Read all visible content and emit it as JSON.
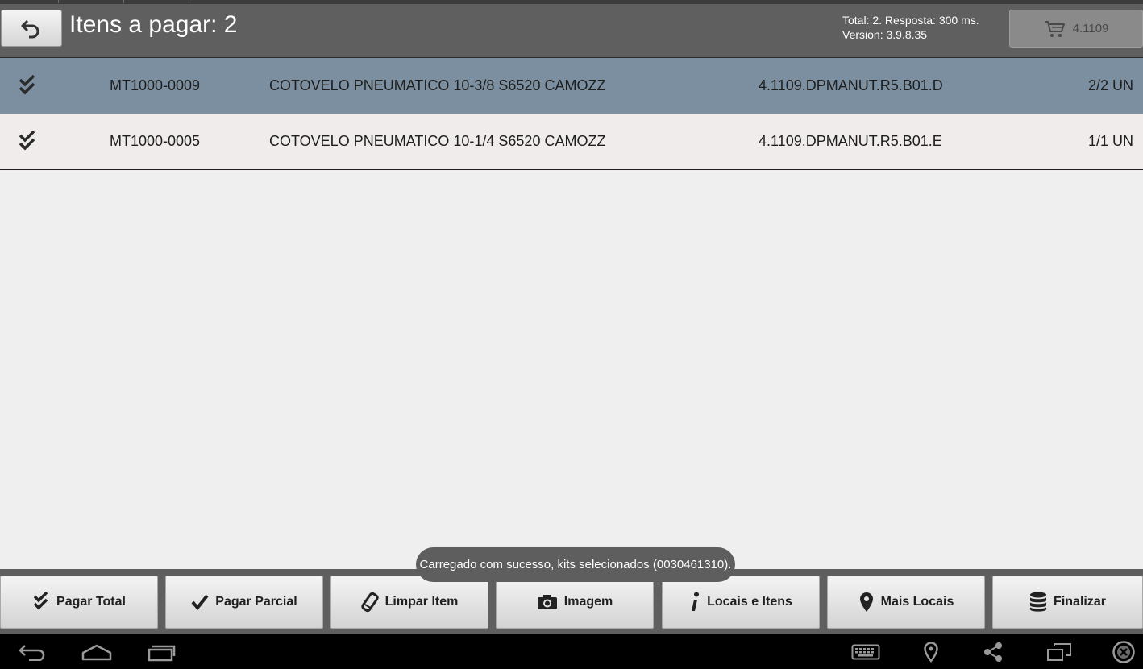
{
  "header": {
    "title": "Itens a pagar: 2",
    "status_line1": "Total: 2. Resposta: 300 ms.",
    "status_line2": "Version: 3.9.8.35",
    "cart_label": "4.1109",
    "back_icon": "undo-arrow-icon",
    "cart_icon": "shopping-cart-icon"
  },
  "items": [
    {
      "code": "MT1000-0009",
      "description": "COTOVELO PNEUMATICO 10-3/8 S6520 CAMOZZ",
      "location": "4.1109.DPMANUT.R5.B01.D",
      "quantity": "2/2 UN",
      "icon": "double-check-icon",
      "selected": true
    },
    {
      "code": "MT1000-0005",
      "description": "COTOVELO PNEUMATICO 10-1/4 S6520 CAMOZZ",
      "location": "4.1109.DPMANUT.R5.B01.E",
      "quantity": "1/1 UN",
      "icon": "double-check-icon",
      "selected": false
    }
  ],
  "toast": "Carregado com sucesso, kits selecionados (0030461310).",
  "actions": [
    {
      "label": "Pagar Total",
      "icon": "double-check-icon"
    },
    {
      "label": "Pagar Parcial",
      "icon": "check-icon"
    },
    {
      "label": "Limpar Item",
      "icon": "eraser-icon"
    },
    {
      "label": "Imagem",
      "icon": "camera-icon"
    },
    {
      "label": "Locais e Itens",
      "icon": "info-icon"
    },
    {
      "label": "Mais Locais",
      "icon": "map-marker-icon"
    },
    {
      "label": "Finalizar",
      "icon": "database-icon"
    }
  ],
  "colors": {
    "header_bg": "#5f5f5f",
    "selected_row": "#7b8fa0",
    "row_bg": "#f1ecec",
    "page_bg": "#efefef",
    "nav_bg": "#000000"
  }
}
